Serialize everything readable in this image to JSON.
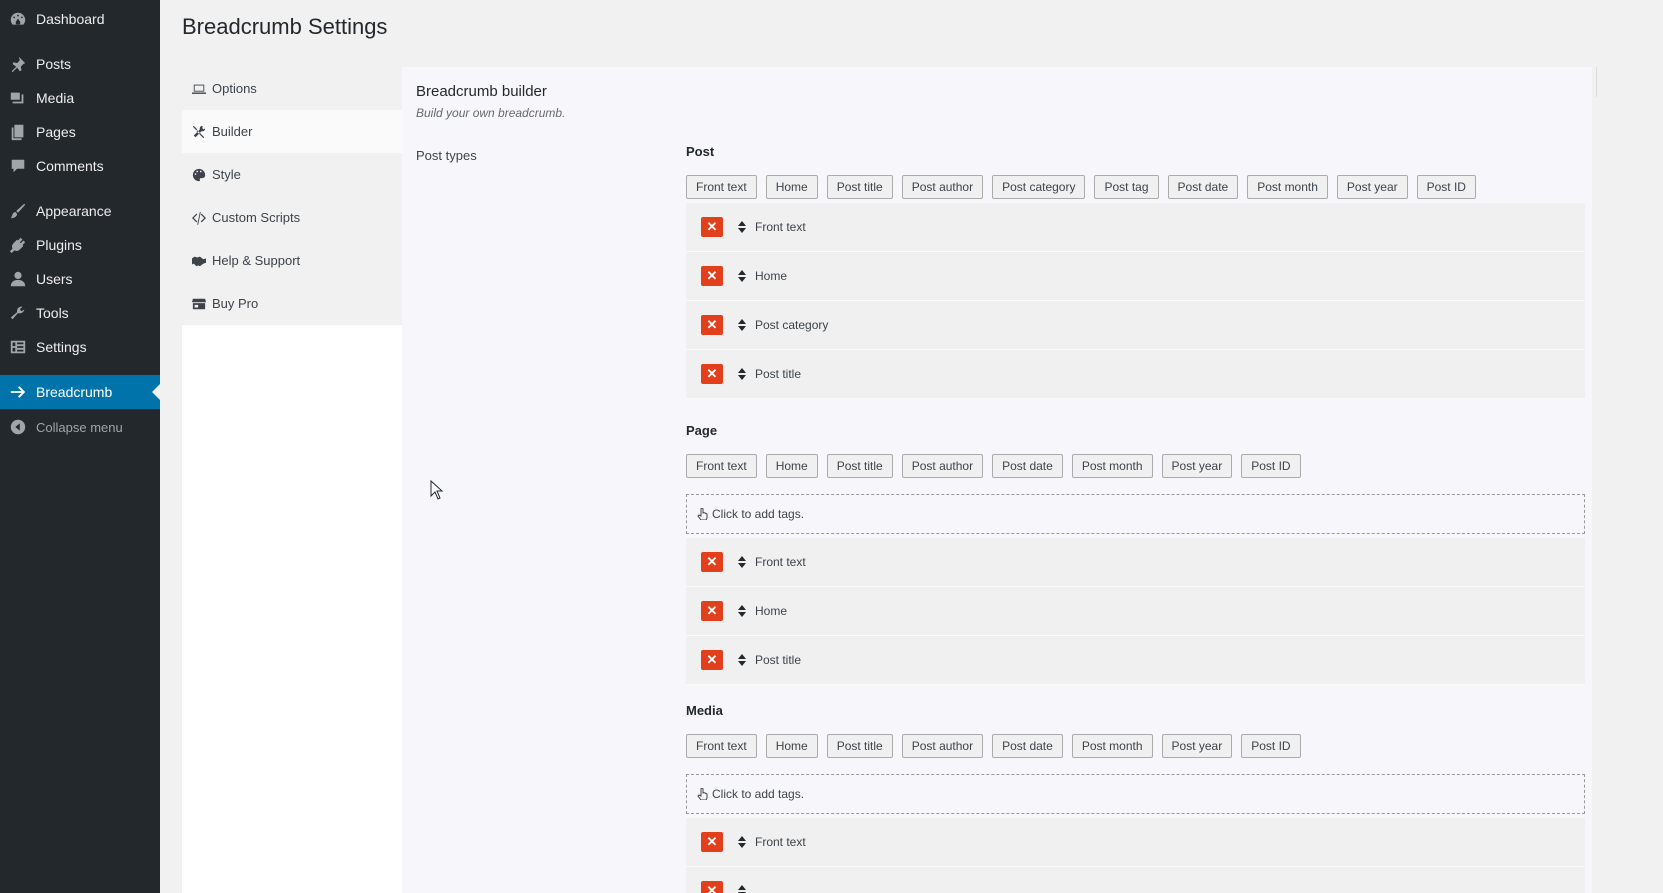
{
  "admin_menu": {
    "items": [
      {
        "label": "Dashboard",
        "icon": "dashboard-icon"
      },
      {
        "label": "Posts",
        "icon": "pin-icon"
      },
      {
        "label": "Media",
        "icon": "media-icon"
      },
      {
        "label": "Pages",
        "icon": "pages-icon"
      },
      {
        "label": "Comments",
        "icon": "comment-icon"
      },
      {
        "label": "Appearance",
        "icon": "brush-icon"
      },
      {
        "label": "Plugins",
        "icon": "plugin-icon"
      },
      {
        "label": "Users",
        "icon": "user-icon"
      },
      {
        "label": "Tools",
        "icon": "wrench-icon"
      },
      {
        "label": "Settings",
        "icon": "settings-icon"
      },
      {
        "label": "Breadcrumb",
        "icon": "arrow-right-icon",
        "current": true
      },
      {
        "label": "Collapse menu",
        "icon": "collapse-icon"
      }
    ],
    "colors": {
      "background": "#23282d",
      "current": "#0073aa"
    }
  },
  "page_title": "Breadcrumb Settings",
  "settings_nav": {
    "items": [
      {
        "label": "Options",
        "icon": "laptop-icon"
      },
      {
        "label": "Builder",
        "icon": "tools-icon",
        "active": true
      },
      {
        "label": "Style",
        "icon": "palette-icon"
      },
      {
        "label": "Custom Scripts",
        "icon": "code-icon"
      },
      {
        "label": "Help & Support",
        "icon": "handshake-icon"
      },
      {
        "label": "Buy Pro",
        "icon": "store-icon"
      }
    ]
  },
  "builder": {
    "title": "Breadcrumb builder",
    "description": "Build your own breadcrumb.",
    "post_types_label": "Post types",
    "add_tags_text": "Click to add tags.",
    "delete_color": "#e2401c",
    "sections": [
      {
        "name": "Post",
        "tags": [
          "Front text",
          "Home",
          "Post title",
          "Post author",
          "Post category",
          "Post tag",
          "Post date",
          "Post month",
          "Post year",
          "Post ID"
        ],
        "show_add": false,
        "items": [
          "Front text",
          "Home",
          "Post category",
          "Post title"
        ]
      },
      {
        "name": "Page",
        "tags": [
          "Front text",
          "Home",
          "Post title",
          "Post author",
          "Post date",
          "Post month",
          "Post year",
          "Post ID"
        ],
        "show_add": true,
        "items": [
          "Front text",
          "Home",
          "Post title"
        ]
      },
      {
        "name": "Media",
        "tags": [
          "Front text",
          "Home",
          "Post title",
          "Post author",
          "Post date",
          "Post month",
          "Post year",
          "Post ID"
        ],
        "show_add": true,
        "items": [
          "Front text",
          ""
        ]
      }
    ]
  }
}
